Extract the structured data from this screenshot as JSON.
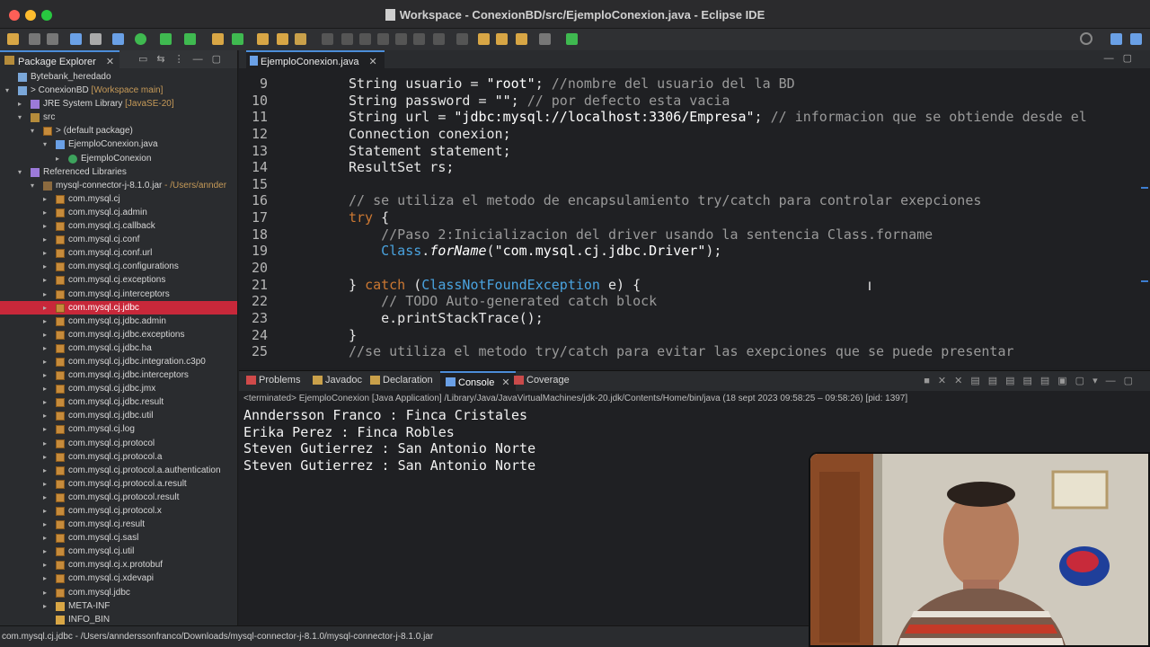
{
  "window": {
    "title": "Workspace - ConexionBD/src/EjemploConexion.java - Eclipse IDE"
  },
  "package_explorer": {
    "tab_label": "Package Explorer",
    "items": [
      {
        "label": "Bytebank_heredado",
        "extra": "",
        "depth": 0,
        "arrow": "",
        "icon": "proj"
      },
      {
        "label": "> ConexionBD",
        "extra": " [Workspace main]",
        "depth": 0,
        "arrow": "▾",
        "icon": "proj"
      },
      {
        "label": "JRE System Library",
        "extra": " [JavaSE-20]",
        "depth": 1,
        "arrow": "▸",
        "icon": "lib"
      },
      {
        "label": "src",
        "extra": "",
        "depth": 1,
        "arrow": "▾",
        "icon": "src"
      },
      {
        "label": "> (default package)",
        "extra": "",
        "depth": 2,
        "arrow": "▾",
        "icon": "pkgi"
      },
      {
        "label": "EjemploConexion.java",
        "extra": "",
        "depth": 3,
        "arrow": "▾",
        "icon": "java"
      },
      {
        "label": "EjemploConexion",
        "extra": "",
        "depth": 4,
        "arrow": "▸",
        "icon": "cls"
      },
      {
        "label": "Referenced Libraries",
        "extra": "",
        "depth": 1,
        "arrow": "▾",
        "icon": "lib"
      },
      {
        "label": "mysql-connector-j-8.1.0.jar",
        "extra": " - /Users/annder",
        "depth": 2,
        "arrow": "▾",
        "icon": "jar"
      },
      {
        "label": "com.mysql.cj",
        "extra": "",
        "depth": 3,
        "arrow": "▸",
        "icon": "pkgi"
      },
      {
        "label": "com.mysql.cj.admin",
        "extra": "",
        "depth": 3,
        "arrow": "▸",
        "icon": "pkgi"
      },
      {
        "label": "com.mysql.cj.callback",
        "extra": "",
        "depth": 3,
        "arrow": "▸",
        "icon": "pkgi"
      },
      {
        "label": "com.mysql.cj.conf",
        "extra": "",
        "depth": 3,
        "arrow": "▸",
        "icon": "pkgi"
      },
      {
        "label": "com.mysql.cj.conf.url",
        "extra": "",
        "depth": 3,
        "arrow": "▸",
        "icon": "pkgi"
      },
      {
        "label": "com.mysql.cj.configurations",
        "extra": "",
        "depth": 3,
        "arrow": "▸",
        "icon": "pkgi"
      },
      {
        "label": "com.mysql.cj.exceptions",
        "extra": "",
        "depth": 3,
        "arrow": "▸",
        "icon": "pkgi"
      },
      {
        "label": "com.mysql.cj.interceptors",
        "extra": "",
        "depth": 3,
        "arrow": "▸",
        "icon": "pkgi"
      },
      {
        "label": "com.mysql.cj.jdbc",
        "extra": "",
        "depth": 3,
        "arrow": "▸",
        "icon": "pkgi",
        "selected": true
      },
      {
        "label": "com.mysql.cj.jdbc.admin",
        "extra": "",
        "depth": 3,
        "arrow": "▸",
        "icon": "pkgi"
      },
      {
        "label": "com.mysql.cj.jdbc.exceptions",
        "extra": "",
        "depth": 3,
        "arrow": "▸",
        "icon": "pkgi"
      },
      {
        "label": "com.mysql.cj.jdbc.ha",
        "extra": "",
        "depth": 3,
        "arrow": "▸",
        "icon": "pkgi"
      },
      {
        "label": "com.mysql.cj.jdbc.integration.c3p0",
        "extra": "",
        "depth": 3,
        "arrow": "▸",
        "icon": "pkgi"
      },
      {
        "label": "com.mysql.cj.jdbc.interceptors",
        "extra": "",
        "depth": 3,
        "arrow": "▸",
        "icon": "pkgi"
      },
      {
        "label": "com.mysql.cj.jdbc.jmx",
        "extra": "",
        "depth": 3,
        "arrow": "▸",
        "icon": "pkgi"
      },
      {
        "label": "com.mysql.cj.jdbc.result",
        "extra": "",
        "depth": 3,
        "arrow": "▸",
        "icon": "pkgi"
      },
      {
        "label": "com.mysql.cj.jdbc.util",
        "extra": "",
        "depth": 3,
        "arrow": "▸",
        "icon": "pkgi"
      },
      {
        "label": "com.mysql.cj.log",
        "extra": "",
        "depth": 3,
        "arrow": "▸",
        "icon": "pkgi"
      },
      {
        "label": "com.mysql.cj.protocol",
        "extra": "",
        "depth": 3,
        "arrow": "▸",
        "icon": "pkgi"
      },
      {
        "label": "com.mysql.cj.protocol.a",
        "extra": "",
        "depth": 3,
        "arrow": "▸",
        "icon": "pkgi"
      },
      {
        "label": "com.mysql.cj.protocol.a.authentication",
        "extra": "",
        "depth": 3,
        "arrow": "▸",
        "icon": "pkgi"
      },
      {
        "label": "com.mysql.cj.protocol.a.result",
        "extra": "",
        "depth": 3,
        "arrow": "▸",
        "icon": "pkgi"
      },
      {
        "label": "com.mysql.cj.protocol.result",
        "extra": "",
        "depth": 3,
        "arrow": "▸",
        "icon": "pkgi"
      },
      {
        "label": "com.mysql.cj.protocol.x",
        "extra": "",
        "depth": 3,
        "arrow": "▸",
        "icon": "pkgi"
      },
      {
        "label": "com.mysql.cj.result",
        "extra": "",
        "depth": 3,
        "arrow": "▸",
        "icon": "pkgi"
      },
      {
        "label": "com.mysql.cj.sasl",
        "extra": "",
        "depth": 3,
        "arrow": "▸",
        "icon": "pkgi"
      },
      {
        "label": "com.mysql.cj.util",
        "extra": "",
        "depth": 3,
        "arrow": "▸",
        "icon": "pkgi"
      },
      {
        "label": "com.mysql.cj.x.protobuf",
        "extra": "",
        "depth": 3,
        "arrow": "▸",
        "icon": "pkgi"
      },
      {
        "label": "com.mysql.cj.xdevapi",
        "extra": "",
        "depth": 3,
        "arrow": "▸",
        "icon": "pkgi"
      },
      {
        "label": "com.mysql.jdbc",
        "extra": "",
        "depth": 3,
        "arrow": "▸",
        "icon": "pkgi"
      },
      {
        "label": "META-INF",
        "extra": "",
        "depth": 3,
        "arrow": "▸",
        "icon": "fold"
      },
      {
        "label": "INFO_BIN",
        "extra": "",
        "depth": 3,
        "arrow": "",
        "icon": "fold"
      }
    ]
  },
  "editor": {
    "tab_label": "EjemploConexion.java",
    "lines": [
      {
        "n": "9",
        "parts": [
          [
            "ty",
            "String usuario = "
          ],
          [
            "str",
            "\"root\""
          ],
          [
            "ty",
            "; "
          ],
          [
            "cm",
            "//nombre del usuario del la BD"
          ]
        ]
      },
      {
        "n": "10",
        "parts": [
          [
            "ty",
            "String password = "
          ],
          [
            "str",
            "\"\""
          ],
          [
            "ty",
            "; "
          ],
          [
            "cm",
            "// por defecto esta vacia"
          ]
        ]
      },
      {
        "n": "11",
        "parts": [
          [
            "ty",
            "String url = "
          ],
          [
            "str",
            "\"jdbc:mysql://localhost:3306/Empresa\""
          ],
          [
            "ty",
            "; "
          ],
          [
            "cm",
            "// informacion que se obtiende desde el"
          ]
        ]
      },
      {
        "n": "12",
        "parts": [
          [
            "ty",
            "Connection conexion;"
          ]
        ]
      },
      {
        "n": "13",
        "parts": [
          [
            "ty",
            "Statement statement;"
          ]
        ]
      },
      {
        "n": "14",
        "parts": [
          [
            "ty",
            "ResultSet rs;"
          ]
        ]
      },
      {
        "n": "15",
        "parts": []
      },
      {
        "n": "16",
        "parts": [
          [
            "cm",
            "// se utiliza el metodo de encapsulamiento try/catch para controlar exepciones"
          ]
        ]
      },
      {
        "n": "17",
        "parts": [
          [
            "kw",
            "try"
          ],
          [
            "ty",
            " {"
          ]
        ]
      },
      {
        "n": "18",
        "parts": [
          [
            "cm",
            "    //Paso 2:Inicializacion del driver usando la sentencia Class.forname"
          ]
        ]
      },
      {
        "n": "19",
        "parts": [
          [
            "cls",
            "    Class"
          ],
          [
            "ty",
            "."
          ],
          [
            "mth",
            "forName"
          ],
          [
            "ty",
            "("
          ],
          [
            "str",
            "\"com.mysql.cj.jdbc.Driver\""
          ],
          [
            "ty",
            ");"
          ]
        ]
      },
      {
        "n": "20",
        "parts": []
      },
      {
        "n": "21",
        "parts": [
          [
            "ty",
            "} "
          ],
          [
            "kw",
            "catch"
          ],
          [
            "ty",
            " ("
          ],
          [
            "cls",
            "ClassNotFoundException"
          ],
          [
            "ty",
            " e) {"
          ]
        ]
      },
      {
        "n": "22",
        "parts": [
          [
            "cm",
            "    // TODO Auto-generated catch block"
          ]
        ]
      },
      {
        "n": "23",
        "parts": [
          [
            "ty",
            "    e.printStackTrace();"
          ]
        ]
      },
      {
        "n": "24",
        "parts": [
          [
            "ty",
            "}"
          ]
        ]
      },
      {
        "n": "25",
        "parts": [
          [
            "cm",
            "//se utiliza el metodo try/catch para evitar las exepciones que se puede presentar"
          ]
        ]
      }
    ]
  },
  "console": {
    "tabs": [
      "Problems",
      "Javadoc",
      "Declaration",
      "Console",
      "Coverage"
    ],
    "active_tab": "Console",
    "status": "<terminated> EjemploConexion [Java Application] /Library/Java/JavaVirtualMachines/jdk-20.jdk/Contents/Home/bin/java  (18 sept 2023 09:58:25 – 09:58:26) [pid: 1397]",
    "output": [
      "Anndersson Franco : Finca Cristales",
      "Erika Perez : Finca Robles",
      "Steven Gutierrez : San Antonio Norte",
      "Steven Gutierrez : San Antonio Norte"
    ]
  },
  "status_bar": {
    "text": "com.mysql.cj.jdbc - /Users/annderssonfranco/Downloads/mysql-connector-j-8.1.0/mysql-connector-j-8.1.0.jar"
  },
  "colors": {
    "selection": "#c8283a",
    "keyword": "#cc7832",
    "class": "#4aa3df",
    "accent": "#4c8dd9"
  }
}
